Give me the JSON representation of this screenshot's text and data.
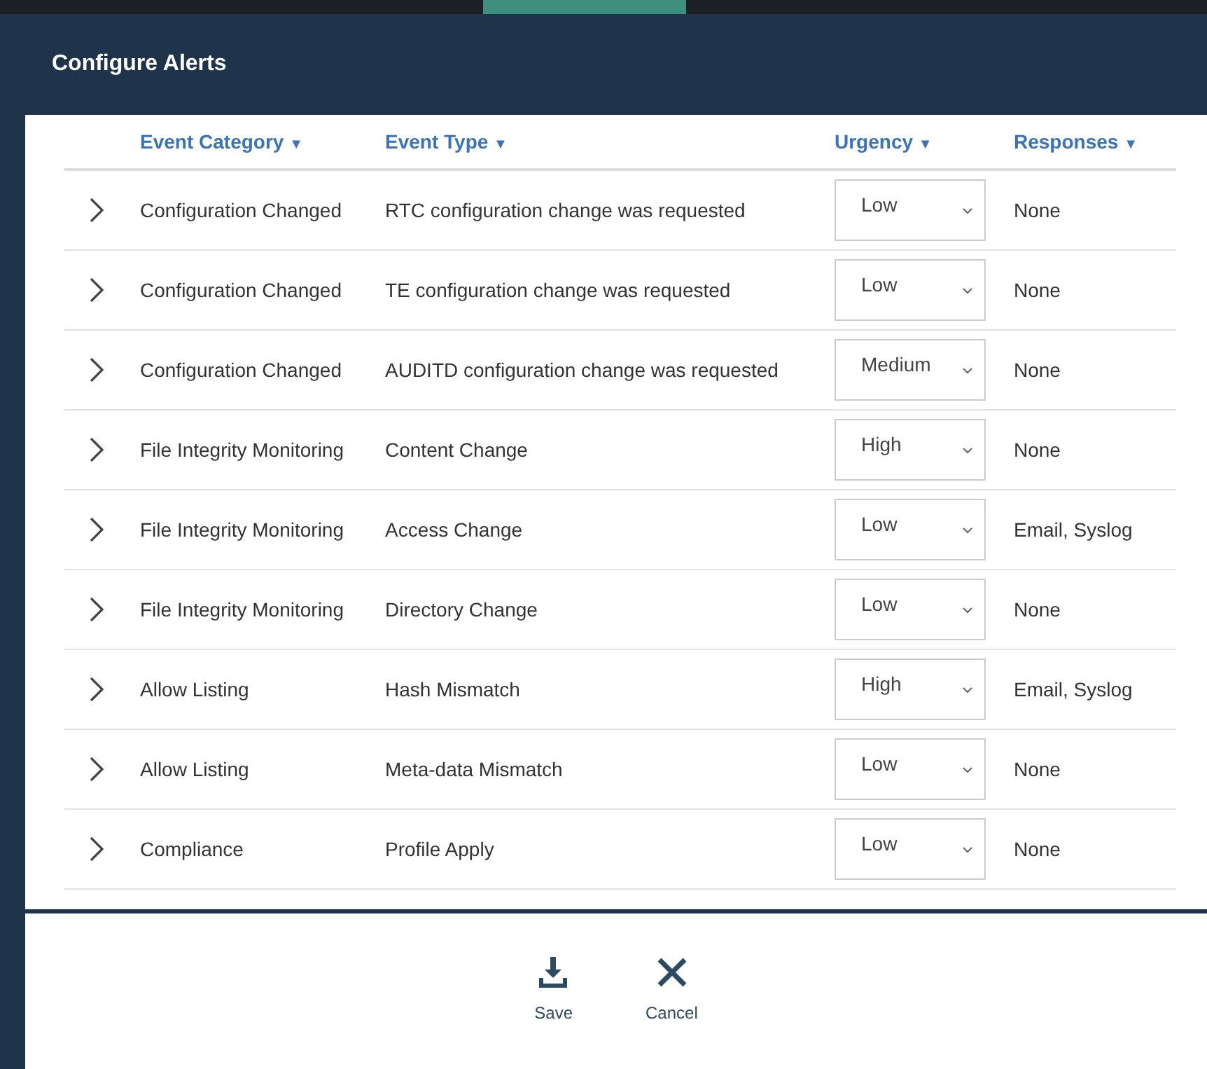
{
  "dialog": {
    "title": "Configure Alerts"
  },
  "table": {
    "columns": [
      {
        "label": "Event Category",
        "sort_icon": "▼"
      },
      {
        "label": "Event Type",
        "sort_icon": "▼"
      },
      {
        "label": "Urgency",
        "sort_icon": "▼"
      },
      {
        "label": "Responses",
        "sort_icon": "▼"
      }
    ],
    "rows": [
      {
        "category": "Configuration Changed",
        "type": "RTC configuration change was requested",
        "urgency": "Low",
        "responses": "None",
        "expanded": false
      },
      {
        "category": "Configuration Changed",
        "type": "TE configuration change was requested",
        "urgency": "Low",
        "responses": "None",
        "expanded": false
      },
      {
        "category": "Configuration Changed",
        "type": "AUDITD configuration change was requested",
        "urgency": "Medium",
        "responses": "None",
        "expanded": false
      },
      {
        "category": "File Integrity Monitoring",
        "type": "Content Change",
        "urgency": "High",
        "responses": "None",
        "expanded": false
      },
      {
        "category": "File Integrity Monitoring",
        "type": "Access Change",
        "urgency": "Low",
        "responses": "Email, Syslog",
        "expanded": false
      },
      {
        "category": "File Integrity Monitoring",
        "type": "Directory Change",
        "urgency": "Low",
        "responses": "None",
        "expanded": false
      },
      {
        "category": "Allow Listing",
        "type": "Hash Mismatch",
        "urgency": "High",
        "responses": "Email, Syslog",
        "expanded": false
      },
      {
        "category": "Allow Listing",
        "type": "Meta-data Mismatch",
        "urgency": "Low",
        "responses": "None",
        "expanded": false
      },
      {
        "category": "Compliance",
        "type": "Profile Apply",
        "urgency": "Low",
        "responses": "None",
        "expanded": false
      }
    ]
  },
  "buttons": [
    {
      "kind": "save",
      "label": "Save"
    },
    {
      "kind": "cancel",
      "label": "Cancel"
    }
  ]
}
